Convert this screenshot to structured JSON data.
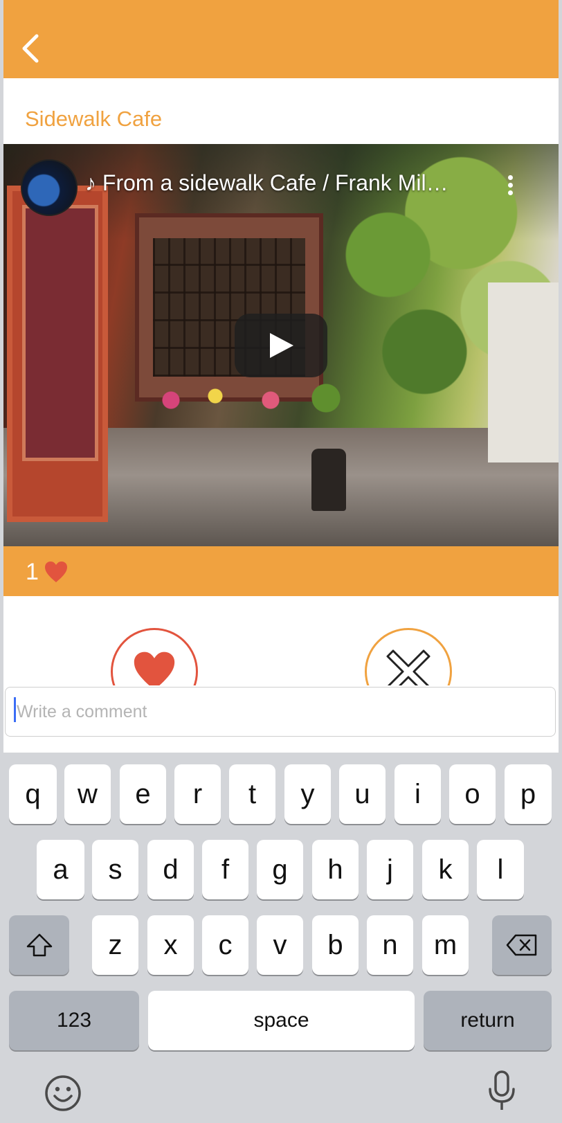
{
  "header": {
    "back_icon": "chevron-left-icon",
    "title": "Sidewalk Cafe"
  },
  "colors": {
    "accent": "#f0a240",
    "like_red": "#e2543e",
    "caret_blue": "#3b6df5"
  },
  "video": {
    "title": "♪ From a sidewalk Cafe / Frank Mil…",
    "channel_avatar": "channel-avatar",
    "more_icon": "more-vertical-icon",
    "play_icon": "play-icon"
  },
  "likes": {
    "count": "1",
    "icon": "heart-icon"
  },
  "actions": {
    "like_icon": "heart-icon",
    "dismiss_icon": "close-x-icon"
  },
  "comment": {
    "placeholder": "Write a comment",
    "value": ""
  },
  "keyboard": {
    "row1": [
      "q",
      "w",
      "e",
      "r",
      "t",
      "y",
      "u",
      "i",
      "o",
      "p"
    ],
    "row2": [
      "a",
      "s",
      "d",
      "f",
      "g",
      "h",
      "j",
      "k",
      "l"
    ],
    "row3": [
      "z",
      "x",
      "c",
      "v",
      "b",
      "n",
      "m"
    ],
    "numbers_label": "123",
    "space_label": "space",
    "return_label": "return",
    "shift_icon": "shift-icon",
    "delete_icon": "backspace-icon",
    "emoji_icon": "emoji-icon",
    "mic_icon": "microphone-icon"
  }
}
